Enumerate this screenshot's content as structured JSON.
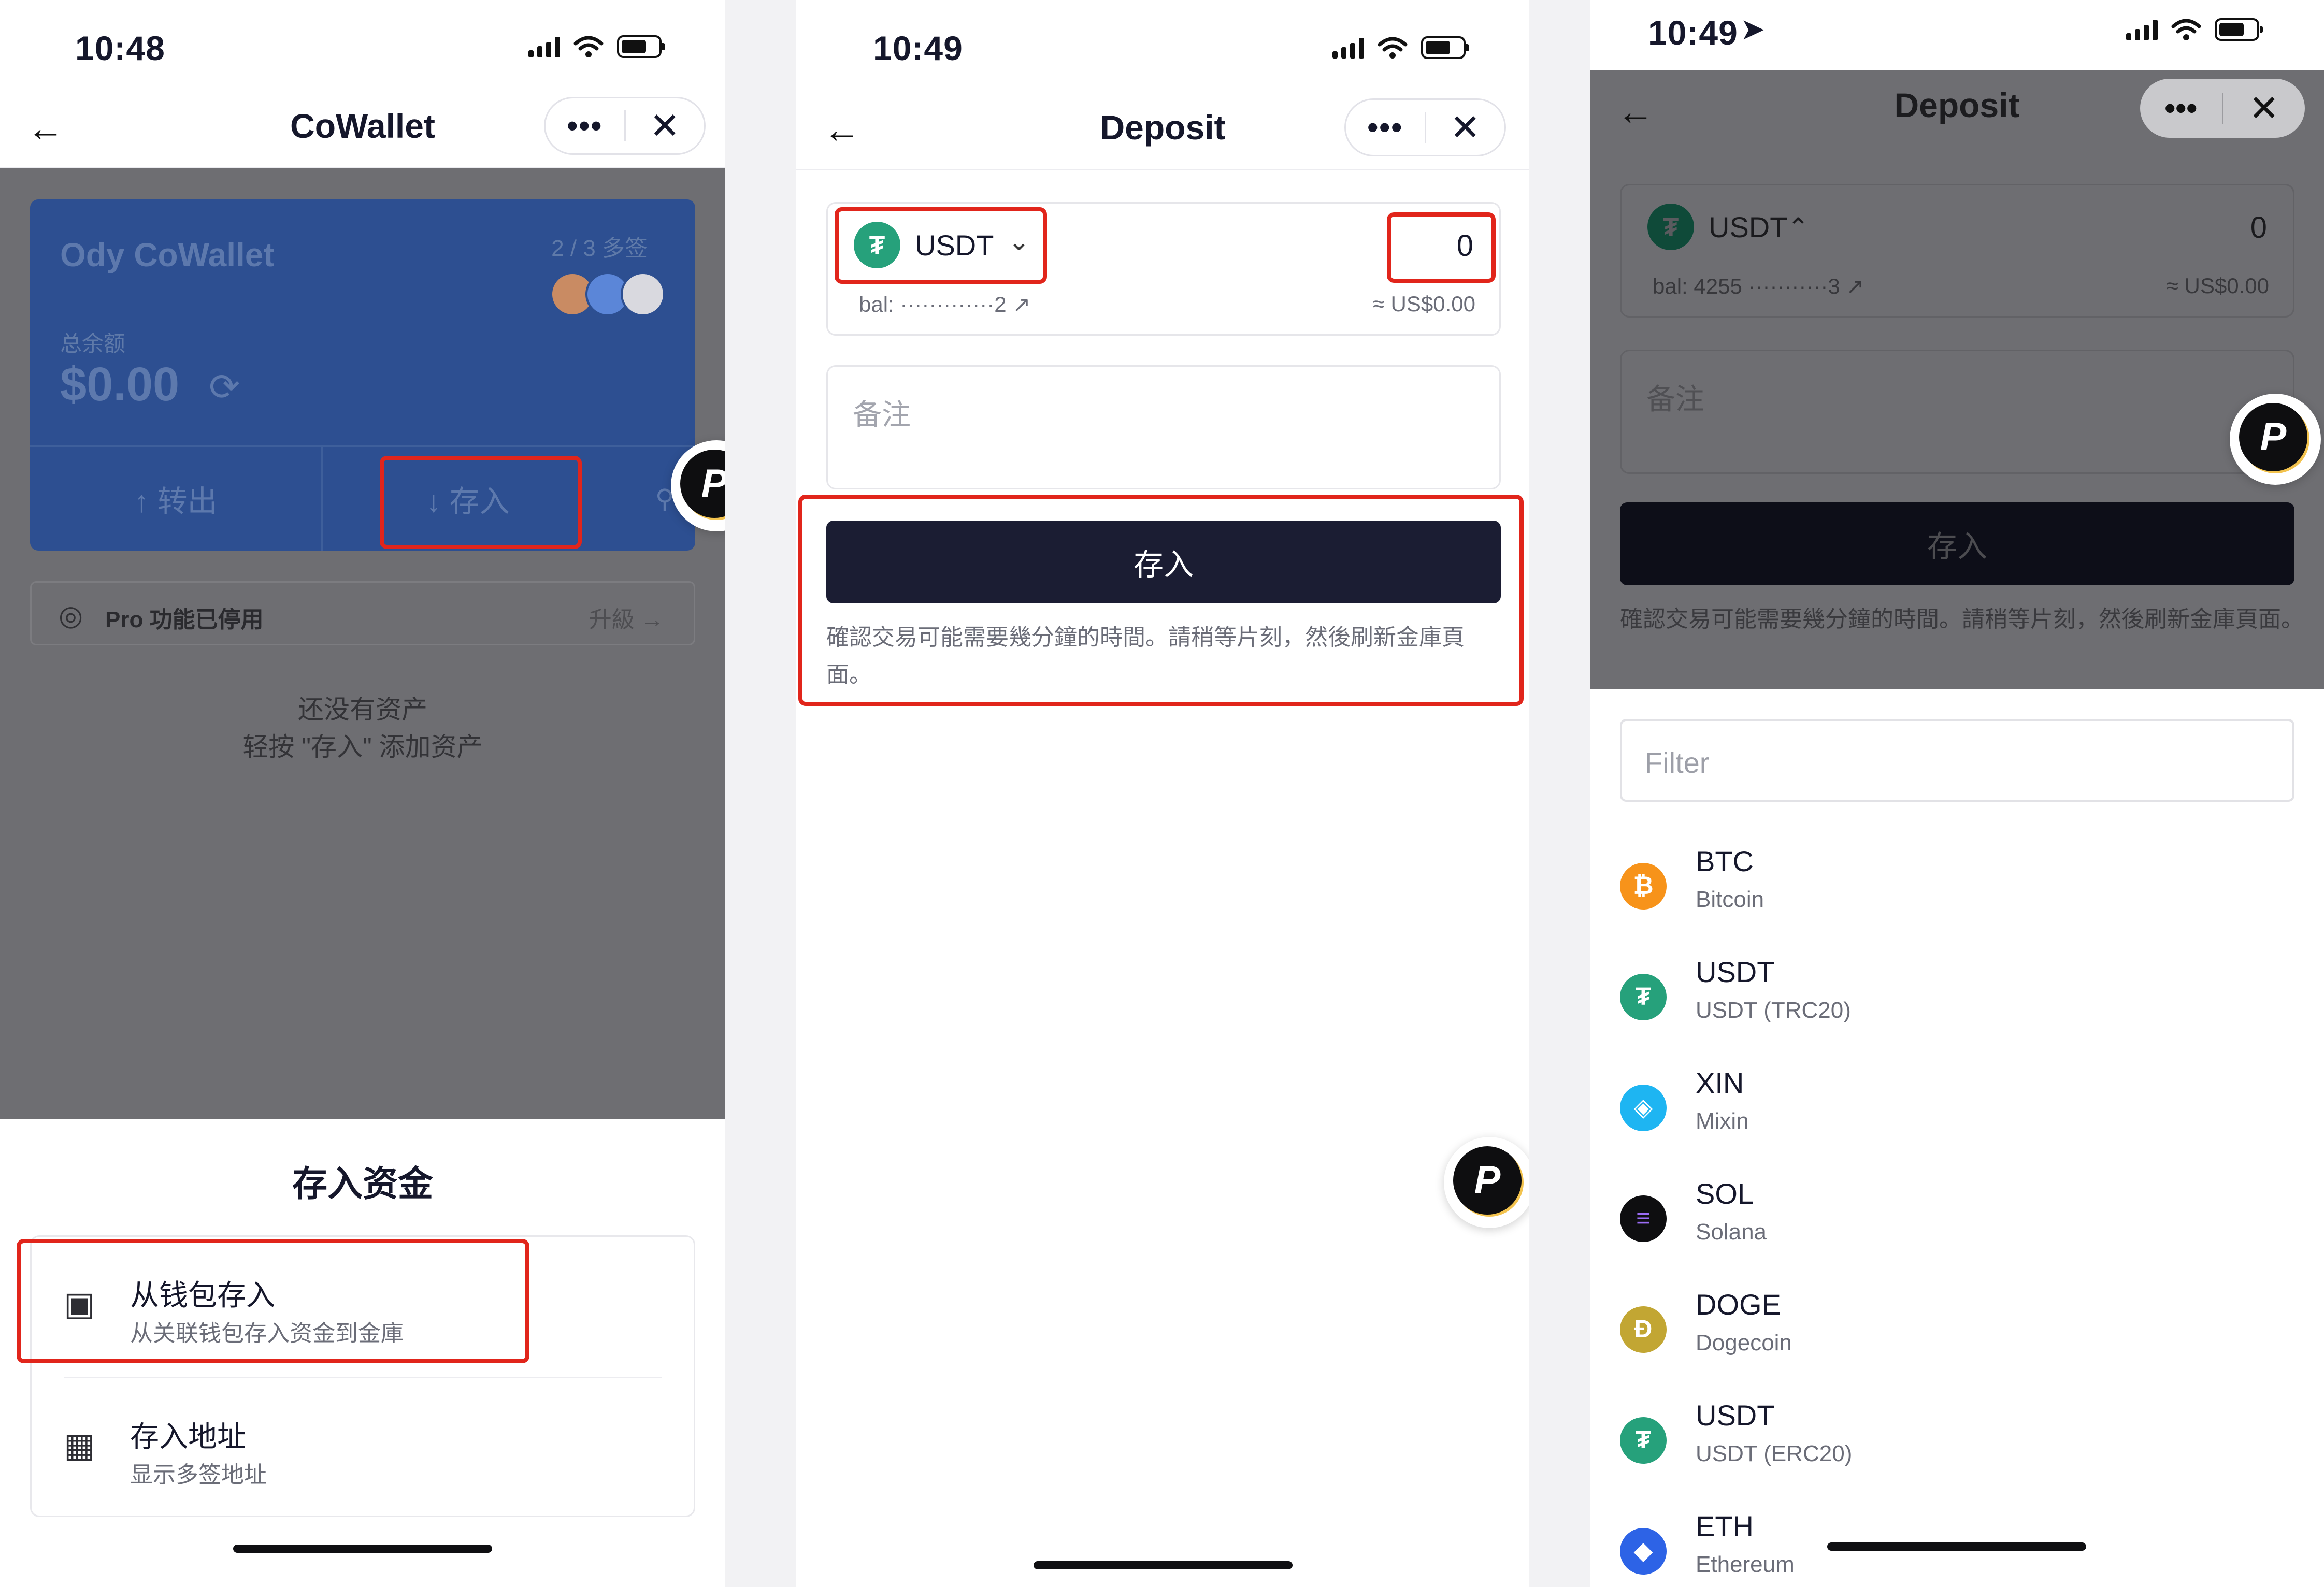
{
  "colors": {
    "accent_dark": "#1b1d33",
    "annotation_red": "#e1251b",
    "usdt_green": "#26a17b",
    "btc_orange": "#f7931a",
    "xin_blue": "#1eb5f2",
    "sol_black": "#0e0e10",
    "doge_gold": "#c2a633",
    "eth_blue": "#2d63e6"
  },
  "screen1": {
    "status_time": "10:48",
    "nav_title": "CoWallet",
    "back_icon": "←",
    "more_icon": "•••",
    "close_icon": "✕",
    "wallet": {
      "name": "Ody CoWallet",
      "signers": "2 / 3 多签",
      "balance_label": "总余额",
      "balance_value": "$0.00",
      "refresh_icon": "⟳",
      "withdraw_label": "↑  转出",
      "deposit_label": "↓  存入",
      "share_icon": "⚲"
    },
    "pro": {
      "icon": "◎",
      "label": "Pro 功能已停用",
      "upgrade": "升級  →"
    },
    "empty": {
      "line1": "还没有资产",
      "line2": "轻按 \"存入\" 添加资产"
    },
    "sheet": {
      "title": "存入资金",
      "options": [
        {
          "icon": "wallet-icon",
          "glyph": "▣",
          "title": "从钱包存入",
          "subtitle": "从关联钱包存入资金到金庫"
        },
        {
          "icon": "qr-code-icon",
          "glyph": "▦",
          "title": "存入地址",
          "subtitle": "显示多签地址"
        }
      ]
    }
  },
  "screen2": {
    "status_time": "10:49",
    "nav_title": "Deposit",
    "back_icon": "←",
    "more_icon": "•••",
    "close_icon": "✕",
    "asset": {
      "symbol": "USDT",
      "chevron": "⌄",
      "amount": "0",
      "balance": "bal: ·············2 ↗",
      "usd": "≈ US$0.00"
    },
    "memo_placeholder": "备注",
    "deposit_button": "存入",
    "note": "確認交易可能需要幾分鐘的時間。請稍等片刻，然後刷新金庫頁面。"
  },
  "screen3": {
    "status_time": "10:49",
    "location_icon": "➤",
    "nav_title": "Deposit",
    "back_icon": "←",
    "more_icon": "•••",
    "close_icon": "✕",
    "asset": {
      "symbol": "USDT",
      "chevron": "⌃",
      "amount": "0",
      "balance": "bal: 4255 ···········3 ↗",
      "usd": "≈ US$0.00"
    },
    "memo_placeholder": "备注",
    "deposit_button": "存入",
    "note": "確認交易可能需要幾分鐘的時間。請稍等片刻，然後刷新金庫頁面。",
    "filter_placeholder": "Filter",
    "coins": [
      {
        "symbol": "BTC",
        "name": "Bitcoin",
        "glyph": "₿",
        "icon": "bitcoin-icon",
        "color": "#f7931a"
      },
      {
        "symbol": "USDT",
        "name": "USDT (TRC20)",
        "glyph": "₮",
        "icon": "tether-icon",
        "color": "#26a17b"
      },
      {
        "symbol": "XIN",
        "name": "Mixin",
        "glyph": "◈",
        "icon": "mixin-icon",
        "color": "#1eb5f2"
      },
      {
        "symbol": "SOL",
        "name": "Solana",
        "glyph": "≡",
        "icon": "solana-icon",
        "color": "#0e0e10"
      },
      {
        "symbol": "DOGE",
        "name": "Dogecoin",
        "glyph": "Ð",
        "icon": "dogecoin-icon",
        "color": "#c2a633"
      },
      {
        "symbol": "USDT",
        "name": "USDT (ERC20)",
        "glyph": "₮",
        "icon": "tether-icon",
        "color": "#26a17b"
      },
      {
        "symbol": "ETH",
        "name": "Ethereum",
        "glyph": "◆",
        "icon": "ethereum-icon",
        "color": "#2d63e6"
      }
    ]
  },
  "floating_button": {
    "glyph": "P"
  },
  "token_glyph": "₮"
}
